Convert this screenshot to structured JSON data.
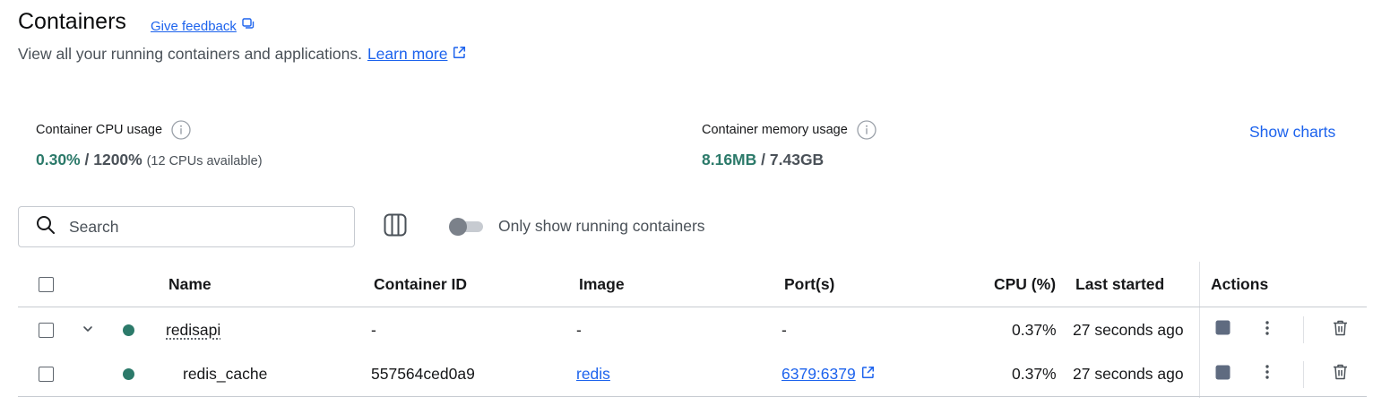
{
  "header": {
    "title": "Containers",
    "feedback_label": "Give feedback",
    "subtitle": "View all your running containers and applications.",
    "learn_more": "Learn more"
  },
  "stats": {
    "cpu": {
      "label": "Container CPU usage",
      "used": "0.30%",
      "total": "/ 1200%",
      "note": "(12 CPUs available)"
    },
    "memory": {
      "label": "Container memory usage",
      "used": "8.16MB",
      "total": "/ 7.43GB"
    },
    "show_charts": "Show charts"
  },
  "toolbar": {
    "search_placeholder": "Search",
    "toggle_label": "Only show running containers",
    "toggle_on": false
  },
  "table": {
    "columns": {
      "name": "Name",
      "container_id": "Container ID",
      "image": "Image",
      "ports": "Port(s)",
      "cpu": "CPU (%)",
      "last_started": "Last started",
      "actions": "Actions"
    },
    "rows": [
      {
        "name": "redisapi",
        "container_id": "-",
        "image": "-",
        "ports": "-",
        "cpu": "0.37%",
        "last_started": "27 seconds ago",
        "status": "running",
        "expandable": true
      },
      {
        "name": "redis_cache",
        "container_id": "557564ced0a9",
        "image": "redis",
        "ports": "6379:6379",
        "cpu": "0.37%",
        "last_started": "27 seconds ago",
        "status": "running",
        "expandable": false
      }
    ]
  },
  "colors": {
    "accent": "#1d63ed",
    "running": "#2c7a6a",
    "text_muted": "#4a5158"
  }
}
